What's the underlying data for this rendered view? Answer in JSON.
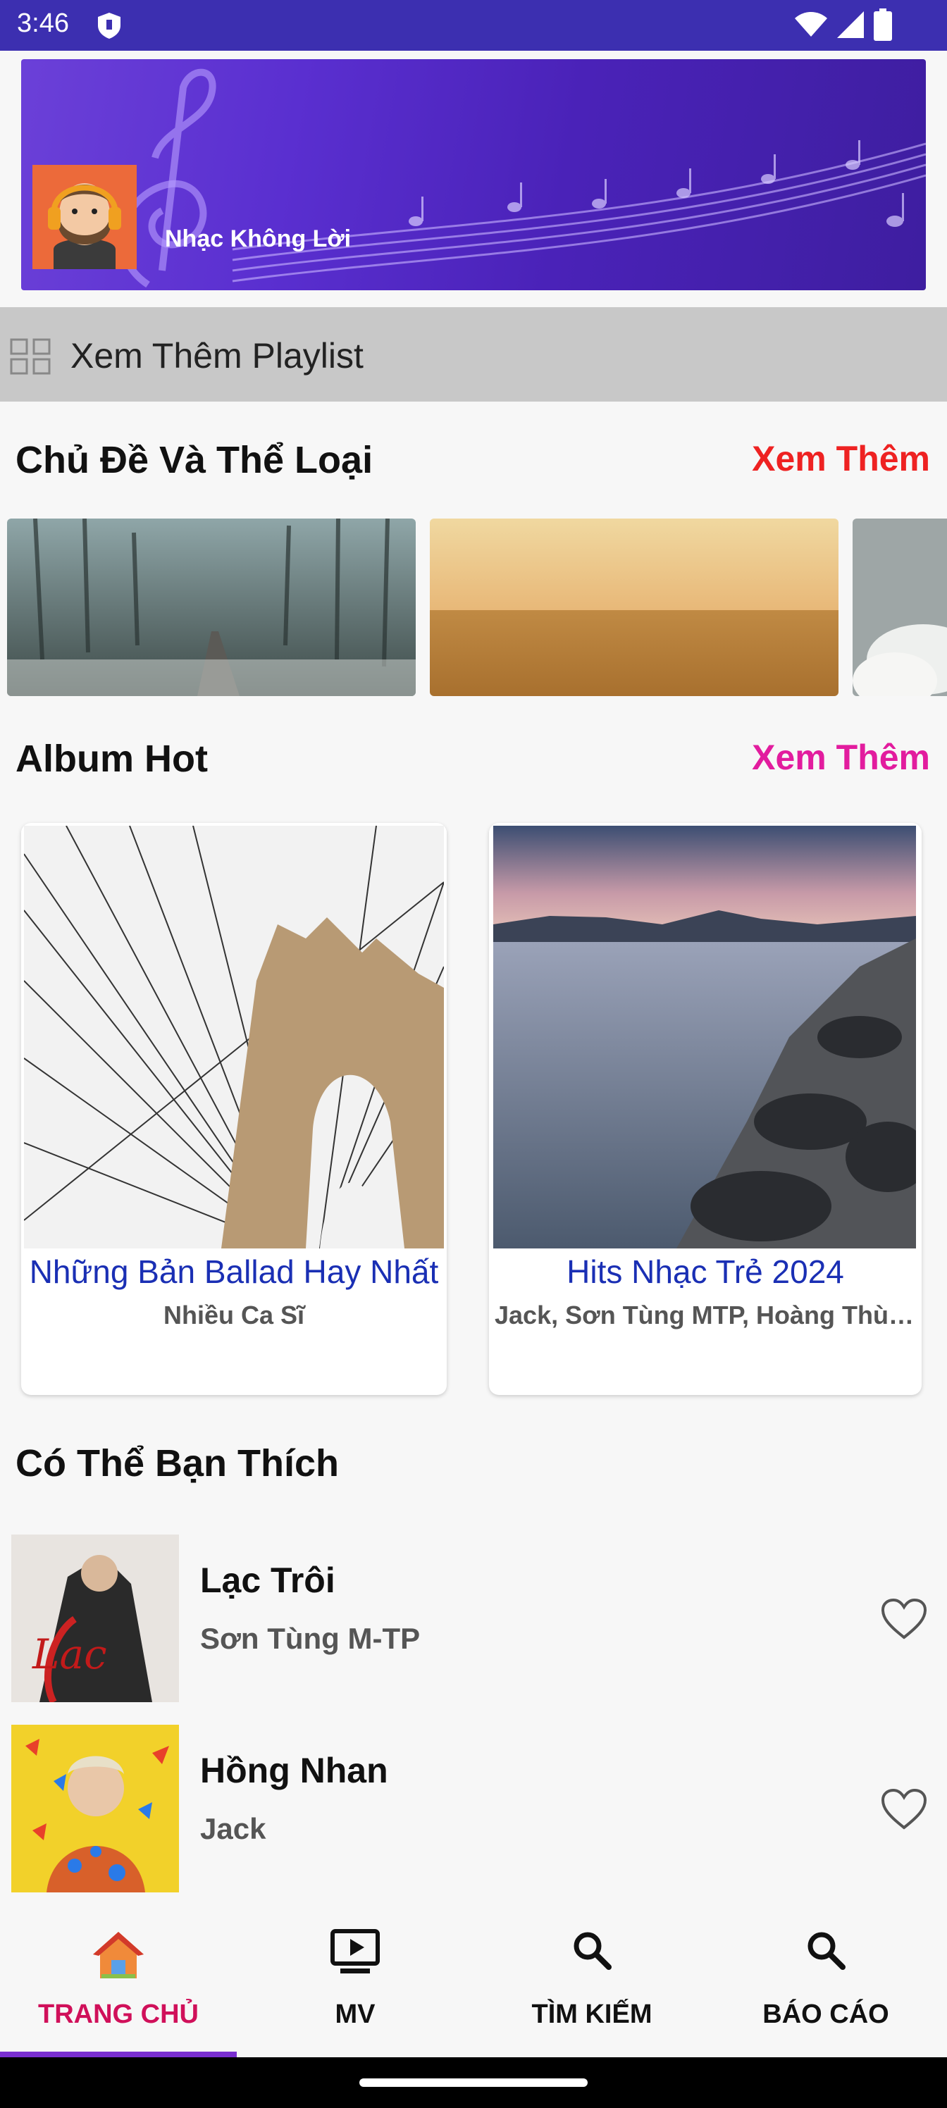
{
  "status_bar": {
    "time": "3:46"
  },
  "banner": {
    "title": "Nhạc Không Lời"
  },
  "playlist_bar": {
    "label": "Xem Thêm Playlist",
    "icon": "grid-icon"
  },
  "genres_section": {
    "title": "Chủ Đề Và Thể Loại",
    "see_more": "Xem Thêm",
    "see_more_color": "#ee2222"
  },
  "albums_section": {
    "title": "Album Hot",
    "see_more": "Xem Thêm",
    "see_more_color": "#e21c9e",
    "albums": [
      {
        "title": "Những Bản Ballad Hay Nhất",
        "artist": "Nhiều Ca Sĩ"
      },
      {
        "title": "Hits Nhạc Trẻ 2024",
        "artist": "Jack, Sơn Tùng MTP, Hoàng Thùy Linh"
      }
    ]
  },
  "suggest_section": {
    "title": "Có Thể Bạn Thích",
    "songs": [
      {
        "title": "Lạc Trôi",
        "artist": "Sơn Tùng M-TP"
      },
      {
        "title": "Hồng Nhan",
        "artist": "Jack"
      }
    ]
  },
  "bottom_nav": {
    "items": [
      {
        "label": "TRANG CHỦ",
        "icon": "home-icon",
        "active": true
      },
      {
        "label": "MV",
        "icon": "tv-play-icon"
      },
      {
        "label": "TÌM KIẾM",
        "icon": "search-icon"
      },
      {
        "label": "BÁO CÁO",
        "icon": "search-icon"
      }
    ],
    "active_color": "#d0105a"
  }
}
